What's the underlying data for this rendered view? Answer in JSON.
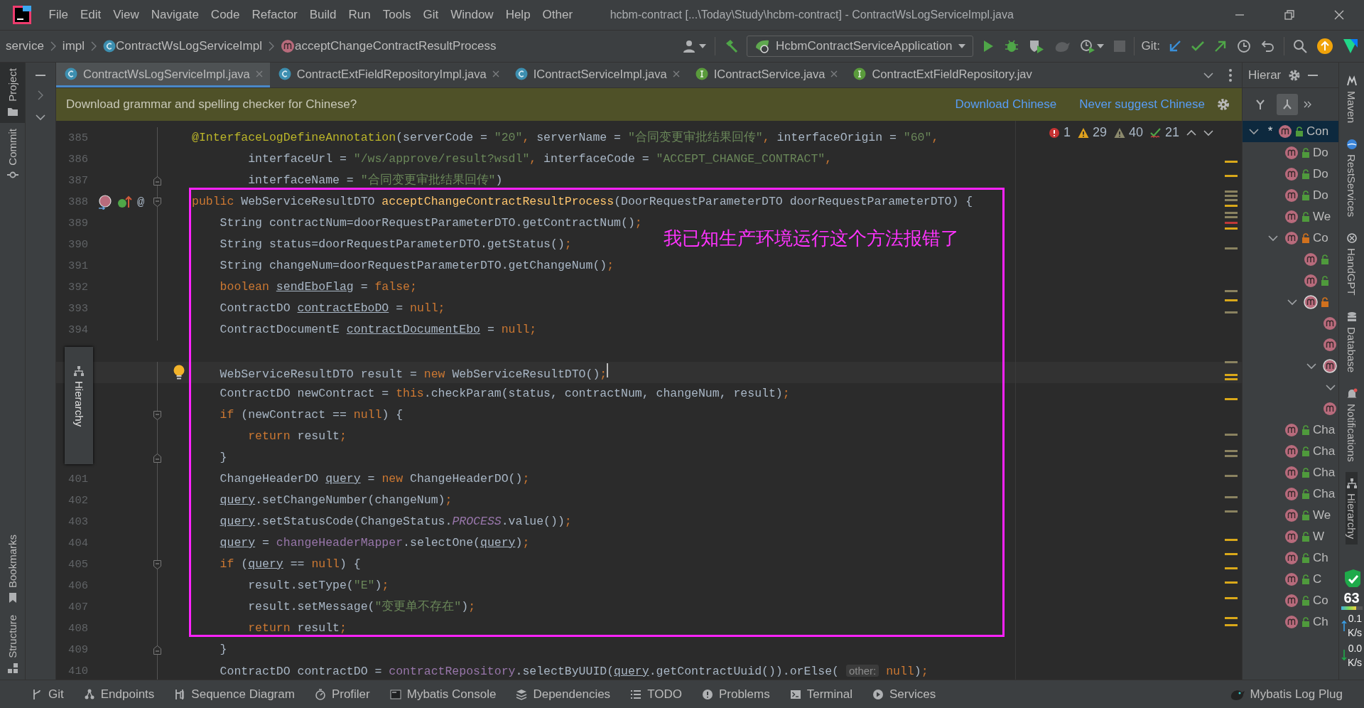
{
  "window": {
    "title": "hcbm-contract [...\\Today\\Study\\hcbm-contract] - ContractWsLogServiceImpl.java"
  },
  "menu": [
    "File",
    "Edit",
    "View",
    "Navigate",
    "Code",
    "Refactor",
    "Build",
    "Run",
    "Tools",
    "Git",
    "Window",
    "Help",
    "Other"
  ],
  "breadcrumbs": [
    {
      "label": "service",
      "kind": "folder"
    },
    {
      "label": "impl",
      "kind": "folder"
    },
    {
      "label": "ContractWsLogServiceImpl",
      "kind": "class"
    },
    {
      "label": "acceptChangeContractResultProcess",
      "kind": "method"
    }
  ],
  "run_config": {
    "label": "HcbmContractServiceApplication"
  },
  "git_label": "Git:",
  "left_tools": {
    "top": [
      {
        "label": "Project",
        "kind": "folder",
        "selected": true
      },
      {
        "label": "Commit",
        "kind": "commit",
        "selected": false
      }
    ],
    "bottom": [
      {
        "label": "Bookmarks",
        "kind": "bookmark",
        "selected": false
      },
      {
        "label": "Structure",
        "kind": "structure",
        "selected": false
      }
    ]
  },
  "tabs": [
    {
      "label": "ContractWsLogServiceImpl.java",
      "kind": "class",
      "selected": true,
      "closable": true
    },
    {
      "label": "ContractExtFieldRepositoryImpl.java",
      "kind": "class",
      "selected": false,
      "closable": true
    },
    {
      "label": "IContractServiceImpl.java",
      "kind": "class",
      "selected": false,
      "closable": true
    },
    {
      "label": "IContractService.java",
      "kind": "interface",
      "selected": false,
      "closable": true
    },
    {
      "label": "ContractExtFieldRepository.jav",
      "kind": "interface",
      "selected": false,
      "closable": false
    }
  ],
  "notification": {
    "message": "Download grammar and spelling checker for Chinese?",
    "actions": [
      "Download Chinese",
      "Never suggest Chinese"
    ]
  },
  "editor": {
    "inspections": [
      {
        "kind": "error",
        "count": "1"
      },
      {
        "kind": "warning",
        "count": "29"
      },
      {
        "kind": "weak",
        "count": "40"
      },
      {
        "kind": "typo",
        "count": "21"
      }
    ],
    "annotation": "我已知生产环境运行这个方法报错了",
    "popup": {
      "label": "Hierarchy"
    },
    "lines": [
      {
        "number": "385",
        "current": false,
        "tokens": [
          {
            "kind": "ann",
            "text": "@InterfaceLogDefineAnnotation"
          },
          {
            "kind": "txt",
            "text": "(serverCode = "
          },
          {
            "kind": "str",
            "text": "\"20\""
          },
          {
            "kind": "kw",
            "text": ","
          },
          {
            "kind": "txt",
            "text": " serverName = "
          },
          {
            "kind": "str",
            "text": "\"合同变更审批结果回传\""
          },
          {
            "kind": "kw",
            "text": ","
          },
          {
            "kind": "txt",
            "text": " interfaceOrigin = "
          },
          {
            "kind": "str",
            "text": "\"60\""
          },
          {
            "kind": "kw",
            "text": ","
          }
        ]
      },
      {
        "number": "386",
        "current": false,
        "tokens": [
          {
            "kind": "txt",
            "text": "        interfaceUrl = "
          },
          {
            "kind": "str",
            "text": "\"/ws/approve/result?wsdl\""
          },
          {
            "kind": "kw",
            "text": ","
          },
          {
            "kind": "txt",
            "text": " interfaceCode = "
          },
          {
            "kind": "str",
            "text": "\"ACCEPT_CHANGE_CONTRACT\""
          },
          {
            "kind": "kw",
            "text": ","
          }
        ]
      },
      {
        "number": "387",
        "current": false,
        "fold": {
          "kind": "end"
        },
        "tokens": [
          {
            "kind": "txt",
            "text": "        interfaceName = "
          },
          {
            "kind": "str",
            "text": "\"合同变更审批结果回传\""
          },
          {
            "kind": "txt",
            "text": ")"
          }
        ]
      },
      {
        "number": "388",
        "current": false,
        "fold": {
          "kind": "start"
        },
        "marks": [
          {
            "kind": "overrides"
          },
          {
            "kind": "implements"
          }
        ],
        "gutter_text": "@",
        "tokens": [
          {
            "kind": "kw",
            "text": "public "
          },
          {
            "kind": "txt",
            "text": "WebServiceResultDTO "
          },
          {
            "kind": "fn",
            "text": "acceptChangeContractResultProcess"
          },
          {
            "kind": "txt",
            "text": "(DoorRequestParameterDTO doorRequestParameterDTO) {"
          }
        ]
      },
      {
        "number": "389",
        "current": false,
        "tokens": [
          {
            "kind": "txt",
            "text": "    String contractNum=doorRequestParameterDTO.getContractNum()"
          },
          {
            "kind": "kw",
            "text": ";"
          }
        ]
      },
      {
        "number": "390",
        "current": false,
        "tokens": [
          {
            "kind": "txt",
            "text": "    String status=doorRequestParameterDTO.getStatus()"
          },
          {
            "kind": "kw",
            "text": ";"
          }
        ]
      },
      {
        "number": "391",
        "current": false,
        "tokens": [
          {
            "kind": "txt",
            "text": "    String changeNum=doorRequestParameterDTO.getChangeNum()"
          },
          {
            "kind": "kw",
            "text": ";"
          }
        ]
      },
      {
        "number": "392",
        "current": false,
        "tokens": [
          {
            "kind": "kw",
            "text": "    boolean "
          },
          {
            "kind": "var",
            "text": "sendEboFlag"
          },
          {
            "kind": "txt",
            "text": " = "
          },
          {
            "kind": "kw",
            "text": "false;"
          }
        ]
      },
      {
        "number": "393",
        "current": false,
        "tokens": [
          {
            "kind": "txt",
            "text": "    ContractDO "
          },
          {
            "kind": "var",
            "text": "contractEboDO"
          },
          {
            "kind": "txt",
            "text": " = "
          },
          {
            "kind": "kw",
            "text": "null;"
          }
        ]
      },
      {
        "number": "394",
        "current": false,
        "blank_after": true,
        "tokens": [
          {
            "kind": "txt",
            "text": "    ContractDocumentE "
          },
          {
            "kind": "var",
            "text": "contractDocumentEbo"
          },
          {
            "kind": "txt",
            "text": " = "
          },
          {
            "kind": "kw",
            "text": "null;"
          }
        ]
      },
      {
        "current": true,
        "bulb": true,
        "tokens": [
          {
            "kind": "txt",
            "text": "    WebServiceResultDTO result = "
          },
          {
            "kind": "kw",
            "text": "new "
          },
          {
            "kind": "txt",
            "text": "WebServiceResultDTO()"
          },
          {
            "kind": "kw",
            "text": ";"
          }
        ]
      },
      {
        "current": false,
        "tokens": [
          {
            "kind": "txt",
            "text": "    ContractDO newContract = "
          },
          {
            "kind": "kw",
            "text": "this"
          },
          {
            "kind": "txt",
            "text": ".checkParam(status, contractNum, changeNum, result)"
          },
          {
            "kind": "kw",
            "text": ";"
          }
        ]
      },
      {
        "current": false,
        "fold": {
          "kind": "start"
        },
        "tokens": [
          {
            "kind": "kw",
            "text": "    if "
          },
          {
            "kind": "txt",
            "text": "(newContract == "
          },
          {
            "kind": "kw",
            "text": "null"
          },
          {
            "kind": "txt",
            "text": ") {"
          }
        ]
      },
      {
        "current": false,
        "tokens": [
          {
            "kind": "kw",
            "text": "        return "
          },
          {
            "kind": "txt",
            "text": "result"
          },
          {
            "kind": "kw",
            "text": ";"
          }
        ]
      },
      {
        "current": false,
        "fold": {
          "kind": "end"
        },
        "tokens": [
          {
            "kind": "txt",
            "text": "    }"
          }
        ]
      },
      {
        "number": "401",
        "current": false,
        "tokens": [
          {
            "kind": "txt",
            "text": "    ChangeHeaderDO "
          },
          {
            "kind": "var",
            "text": "query"
          },
          {
            "kind": "txt",
            "text": " = "
          },
          {
            "kind": "kw",
            "text": "new "
          },
          {
            "kind": "txt",
            "text": "ChangeHeaderDO()"
          },
          {
            "kind": "kw",
            "text": ";"
          }
        ]
      },
      {
        "number": "402",
        "current": false,
        "tokens": [
          {
            "kind": "var",
            "text": "    query"
          },
          {
            "kind": "txt",
            "text": ".setChangeNumber(changeNum)"
          },
          {
            "kind": "kw",
            "text": ";"
          }
        ]
      },
      {
        "number": "403",
        "current": false,
        "tokens": [
          {
            "kind": "var",
            "text": "    query"
          },
          {
            "kind": "txt",
            "text": ".setStatusCode(ChangeStatus."
          },
          {
            "kind": "const",
            "text": "PROCESS"
          },
          {
            "kind": "txt",
            "text": ".value())"
          },
          {
            "kind": "kw",
            "text": ";"
          }
        ]
      },
      {
        "number": "404",
        "current": false,
        "tokens": [
          {
            "kind": "var",
            "text": "    query"
          },
          {
            "kind": "txt",
            "text": " = "
          },
          {
            "kind": "fld",
            "text": "changeHeaderMapper"
          },
          {
            "kind": "txt",
            "text": ".selectOne("
          },
          {
            "kind": "var",
            "text": "query"
          },
          {
            "kind": "txt",
            "text": ")"
          },
          {
            "kind": "kw",
            "text": ";"
          }
        ]
      },
      {
        "number": "405",
        "current": false,
        "fold": {
          "kind": "start"
        },
        "tokens": [
          {
            "kind": "kw",
            "text": "    if "
          },
          {
            "kind": "txt",
            "text": "("
          },
          {
            "kind": "var",
            "text": "query"
          },
          {
            "kind": "txt",
            "text": " == "
          },
          {
            "kind": "kw",
            "text": "null"
          },
          {
            "kind": "txt",
            "text": ") {"
          }
        ]
      },
      {
        "number": "406",
        "current": false,
        "tokens": [
          {
            "kind": "txt",
            "text": "        result.setType("
          },
          {
            "kind": "str",
            "text": "\"E\""
          },
          {
            "kind": "txt",
            "text": ")"
          },
          {
            "kind": "kw",
            "text": ";"
          }
        ]
      },
      {
        "number": "407",
        "current": false,
        "tokens": [
          {
            "kind": "txt",
            "text": "        result.setMessage("
          },
          {
            "kind": "str",
            "text": "\"变更单不存在\""
          },
          {
            "kind": "txt",
            "text": ")"
          },
          {
            "kind": "kw",
            "text": ";"
          }
        ]
      },
      {
        "number": "408",
        "current": false,
        "tokens": [
          {
            "kind": "kw",
            "text": "        return "
          },
          {
            "kind": "txt",
            "text": "result"
          },
          {
            "kind": "kw",
            "text": ";"
          }
        ]
      },
      {
        "number": "409",
        "current": false,
        "fold": {
          "kind": "end"
        },
        "tokens": [
          {
            "kind": "txt",
            "text": "    }"
          }
        ]
      },
      {
        "number": "410",
        "current": false,
        "tokens": [
          {
            "kind": "txt",
            "text": "    ContractDO contractDO = "
          },
          {
            "kind": "fld",
            "text": "contractRepository"
          },
          {
            "kind": "txt",
            "text": ".selectByUUID("
          },
          {
            "kind": "var",
            "text": "query"
          },
          {
            "kind": "txt",
            "text": ".getContractUuid()).orElse( "
          },
          {
            "kind": "hint",
            "text": "other:"
          },
          {
            "kind": "kw",
            "text": " null"
          },
          {
            "kind": "txt",
            "text": ")"
          },
          {
            "kind": "kw",
            "text": ";"
          }
        ]
      }
    ]
  },
  "hierarchy_panel": {
    "title": "Hierar",
    "tree": [
      {
        "label": "Con",
        "marker": "*",
        "kind": "method",
        "access": {
          "kind": "public"
        },
        "expanded": true,
        "selected": true,
        "children": [
          {
            "label": "Do",
            "kind": "method",
            "access": {
              "kind": "public"
            },
            "selected": false
          },
          {
            "label": "Do",
            "kind": "method",
            "access": {
              "kind": "public"
            },
            "selected": false
          },
          {
            "label": "Do",
            "kind": "method",
            "access": {
              "kind": "public"
            },
            "selected": false
          },
          {
            "label": "We",
            "kind": "method",
            "access": {
              "kind": "public"
            },
            "selected": false
          },
          {
            "label": "Co",
            "kind": "method",
            "access": {
              "kind": "private"
            },
            "expanded": true,
            "selected": false,
            "children": [
              {
                "kind": "method",
                "access": {
                  "kind": "public"
                },
                "selected": false
              },
              {
                "kind": "method",
                "access": {
                  "kind": "public"
                },
                "selected": false
              },
              {
                "kind": "method",
                "access": {
                  "kind": "private"
                },
                "expanded": true,
                "selected": false,
                "children": [
                  {
                    "kind": "method",
                    "selected": false
                  },
                  {
                    "kind": "method",
                    "selected": false
                  },
                  {
                    "kind": "method",
                    "expanded": true,
                    "selected": false,
                    "children": [
                      {
                        "expanded": true,
                        "selected": false
                      }
                    ]
                  },
                  {
                    "kind": "method",
                    "selected": false
                  }
                ]
              }
            ]
          },
          {
            "label": "Cha",
            "kind": "method",
            "access": {
              "kind": "public"
            },
            "selected": false
          },
          {
            "label": "Cha",
            "kind": "method",
            "access": {
              "kind": "public"
            },
            "selected": false
          },
          {
            "label": "Cha",
            "kind": "method",
            "access": {
              "kind": "public"
            },
            "selected": false
          },
          {
            "label": "Cha",
            "kind": "method",
            "access": {
              "kind": "public"
            },
            "selected": false
          },
          {
            "label": "We",
            "kind": "method",
            "access": {
              "kind": "public"
            },
            "selected": false
          },
          {
            "label": "W",
            "kind": "method",
            "access": {
              "kind": "public"
            },
            "selected": false
          },
          {
            "label": "Ch",
            "kind": "method",
            "access": {
              "kind": "public"
            },
            "selected": false
          },
          {
            "label": "C",
            "kind": "method",
            "access": {
              "kind": "public"
            },
            "selected": false
          },
          {
            "label": "Co",
            "kind": "method",
            "access": {
              "kind": "public"
            },
            "selected": false
          },
          {
            "label": "Ch",
            "kind": "method",
            "access": {
              "kind": "public"
            },
            "selected": false
          }
        ]
      }
    ]
  },
  "right_tools": [
    {
      "label": "Maven",
      "kind": "maven",
      "selected": false
    },
    {
      "label": "RestServices",
      "kind": "rest",
      "selected": false
    },
    {
      "label": "HandGPT",
      "kind": "gpt",
      "selected": false
    },
    {
      "label": "Database",
      "kind": "database",
      "selected": false
    },
    {
      "label": "Notifications",
      "kind": "bell",
      "selected": false
    },
    {
      "label": "Hierarchy",
      "kind": "hierarchy",
      "selected": true
    }
  ],
  "bottom_tools": [
    {
      "label": "Git",
      "kind": "git"
    },
    {
      "label": "Endpoints",
      "kind": "endpoints"
    },
    {
      "label": "Sequence Diagram",
      "kind": "sequence"
    },
    {
      "label": "Profiler",
      "kind": "profiler"
    },
    {
      "label": "Mybatis Console",
      "kind": "console"
    },
    {
      "label": "Dependencies",
      "kind": "dependencies"
    },
    {
      "label": "TODO",
      "kind": "todo"
    },
    {
      "label": "Problems",
      "kind": "problems"
    },
    {
      "label": "Terminal",
      "kind": "terminal"
    },
    {
      "label": "Services",
      "kind": "services"
    }
  ],
  "bottom_right": {
    "label": "Mybatis Log Plug"
  },
  "monitor": {
    "value": "63",
    "level": 0.7,
    "network": [
      {
        "kind": "up",
        "value": "0.1",
        "unit": "K/s"
      },
      {
        "kind": "down",
        "value": "0.0",
        "unit": "K/s"
      }
    ]
  }
}
